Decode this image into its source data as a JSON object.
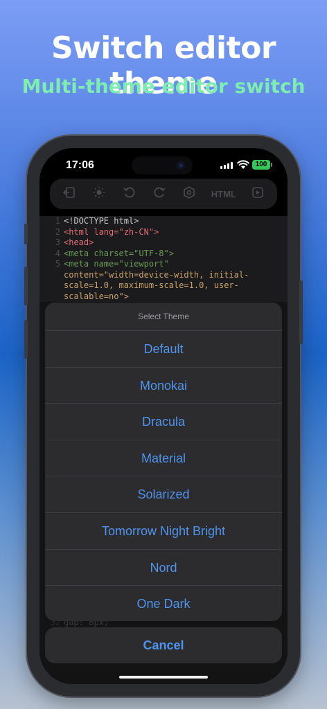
{
  "promo": {
    "headline": "Switch editor theme",
    "subheadline": "Multi-theme editor switch"
  },
  "status_bar": {
    "time": "17:06",
    "battery": "100"
  },
  "toolbar": {
    "html_label": "HTML",
    "icons": [
      "exit-icon",
      "sun-icon",
      "undo-icon",
      "redo-icon",
      "settings-icon",
      "preview-icon"
    ]
  },
  "editor": {
    "lines": [
      {
        "n": "1",
        "text": "<!DOCTYPE html>"
      },
      {
        "n": "2",
        "text": "<html lang=\"zh-CN\">"
      },
      {
        "n": "3",
        "text": "<head>"
      },
      {
        "n": "4",
        "text": "    <meta charset=\"UTF-8\">"
      },
      {
        "n": "5",
        "text": "    <meta name=\"viewport\""
      },
      {
        "n": "",
        "text": "content=\"width=device-width, initial-"
      },
      {
        "n": "",
        "text": "scale=1.0, maximum-scale=1.0, user-"
      },
      {
        "n": "",
        "text": "scalable=no\">"
      }
    ],
    "peek_line": {
      "n": "32",
      "text": "        gap: 8px;"
    }
  },
  "theme_sheet": {
    "title": "Select Theme",
    "options": [
      "Default",
      "Monokai",
      "Dracula",
      "Material",
      "Solarized",
      "Tomorrow Night Bright",
      "Nord",
      "One Dark"
    ],
    "cancel_label": "Cancel"
  },
  "colors": {
    "accent": "#4f93ec",
    "subheadline": "#7dedb0",
    "sheet_bg": "#2c2c2e",
    "battery": "#35c759"
  }
}
